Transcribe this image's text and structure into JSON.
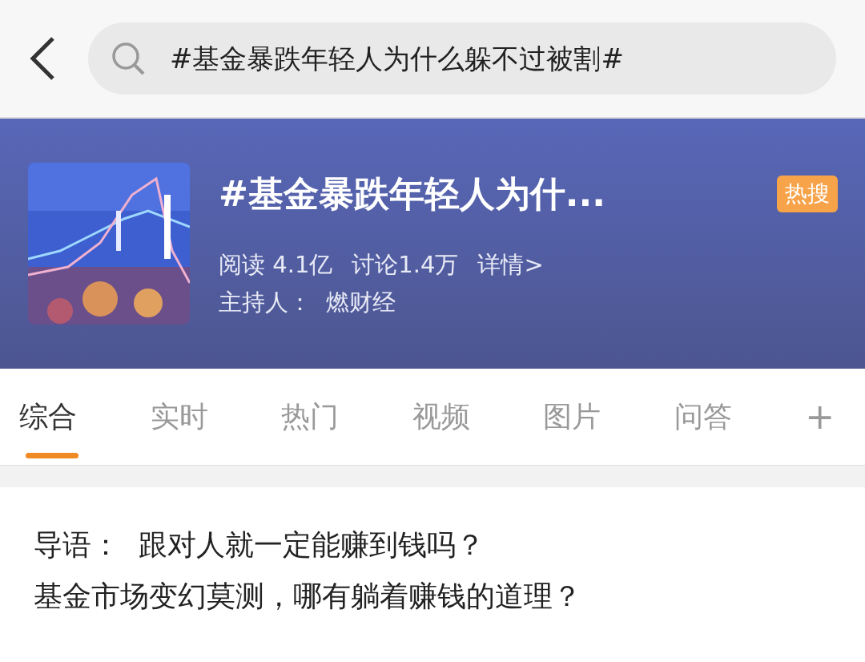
{
  "search": {
    "value": "#基金暴跌年轻人为什么躲不过被割#"
  },
  "topic": {
    "title": "#基金暴跌年轻人为什...",
    "badge": "热搜",
    "stats": [
      "阅读 4.1亿",
      "讨论1.4万",
      "详情>"
    ],
    "host": "主持人：  燃财经"
  },
  "tabs": [
    {
      "label": "综合",
      "selected": true
    },
    {
      "label": "实时",
      "selected": false
    },
    {
      "label": "热门",
      "selected": false
    },
    {
      "label": "视频",
      "selected": false
    },
    {
      "label": "图片",
      "selected": false
    },
    {
      "label": "问答",
      "selected": false
    }
  ],
  "add_tab": "+",
  "intro": [
    "导语：  跟对人就一定能赚到钱吗？",
    "基金市场变幻莫测，哪有躺着赚钱的道理？"
  ]
}
